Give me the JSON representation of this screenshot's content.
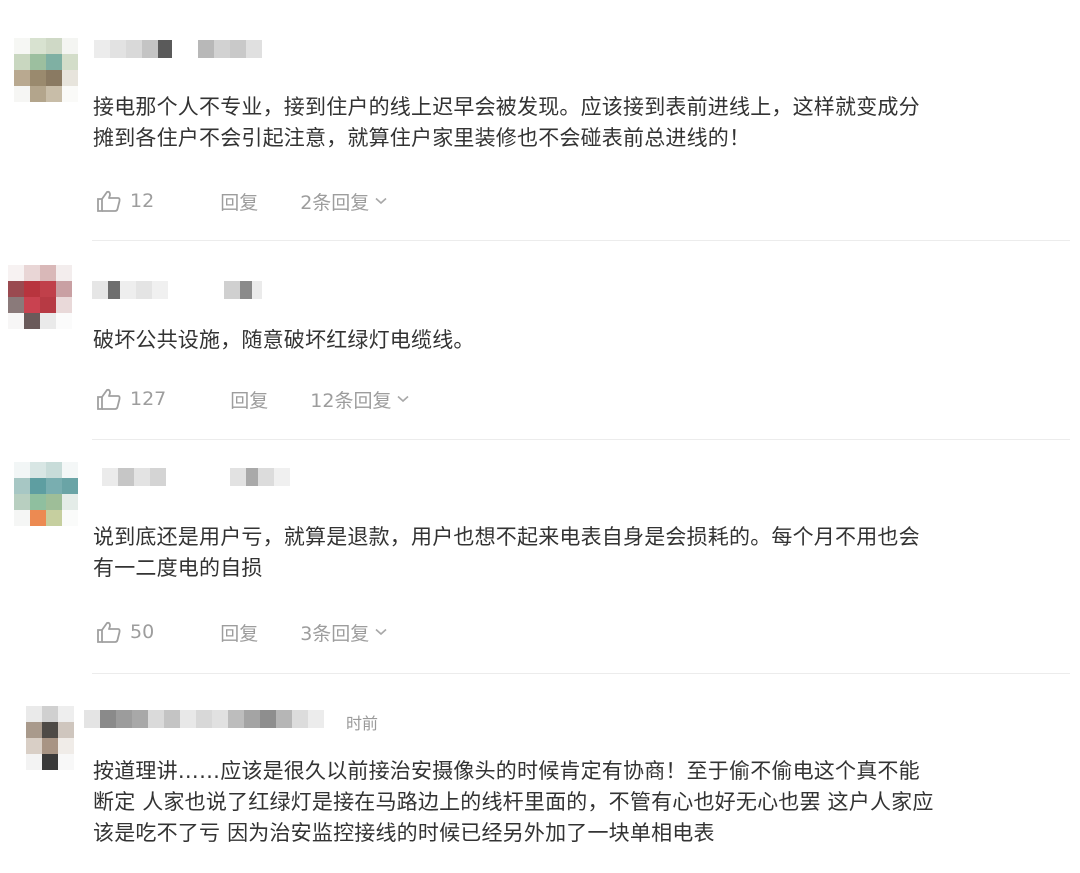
{
  "comments": [
    {
      "text": "接电那个人不专业，接到住户的线上迟早会被发现。应该接到表前进线上，这样就变成分\n摊到各住户不会引起注意，就算住户家里装修也不会碰表前总进线的！",
      "likes": "12",
      "reply_label": "回复",
      "replies_label": "2条回复",
      "time": ""
    },
    {
      "text": "破坏公共设施，随意破坏红绿灯电缆线。",
      "likes": "127",
      "reply_label": "回复",
      "replies_label": "12条回复",
      "time": ""
    },
    {
      "text": "说到底还是用户亏，就算是退款，用户也想不起来电表自身是会损耗的。每个月不用也会\n有一二度电的自损",
      "likes": "50",
      "reply_label": "回复",
      "replies_label": "3条回复",
      "time": ""
    },
    {
      "text": "按道理讲……应该是很久以前接治安摄像头的时候肯定有协商！至于偷不偷电这个真不能\n断定 人家也说了红绿灯是接在马路边上的线杆里面的，不管有心也好无心也罢 这户人家应\n该是吃不了亏 因为治安监控接线的时候已经另外加了一块单相电表",
      "time": "时前"
    }
  ],
  "icons": {
    "like": "thumbs-up-icon",
    "expand": "chevron-down-icon"
  },
  "colors": {
    "text": "#333333",
    "muted": "#9d9d9d",
    "divider": "#ececec"
  }
}
